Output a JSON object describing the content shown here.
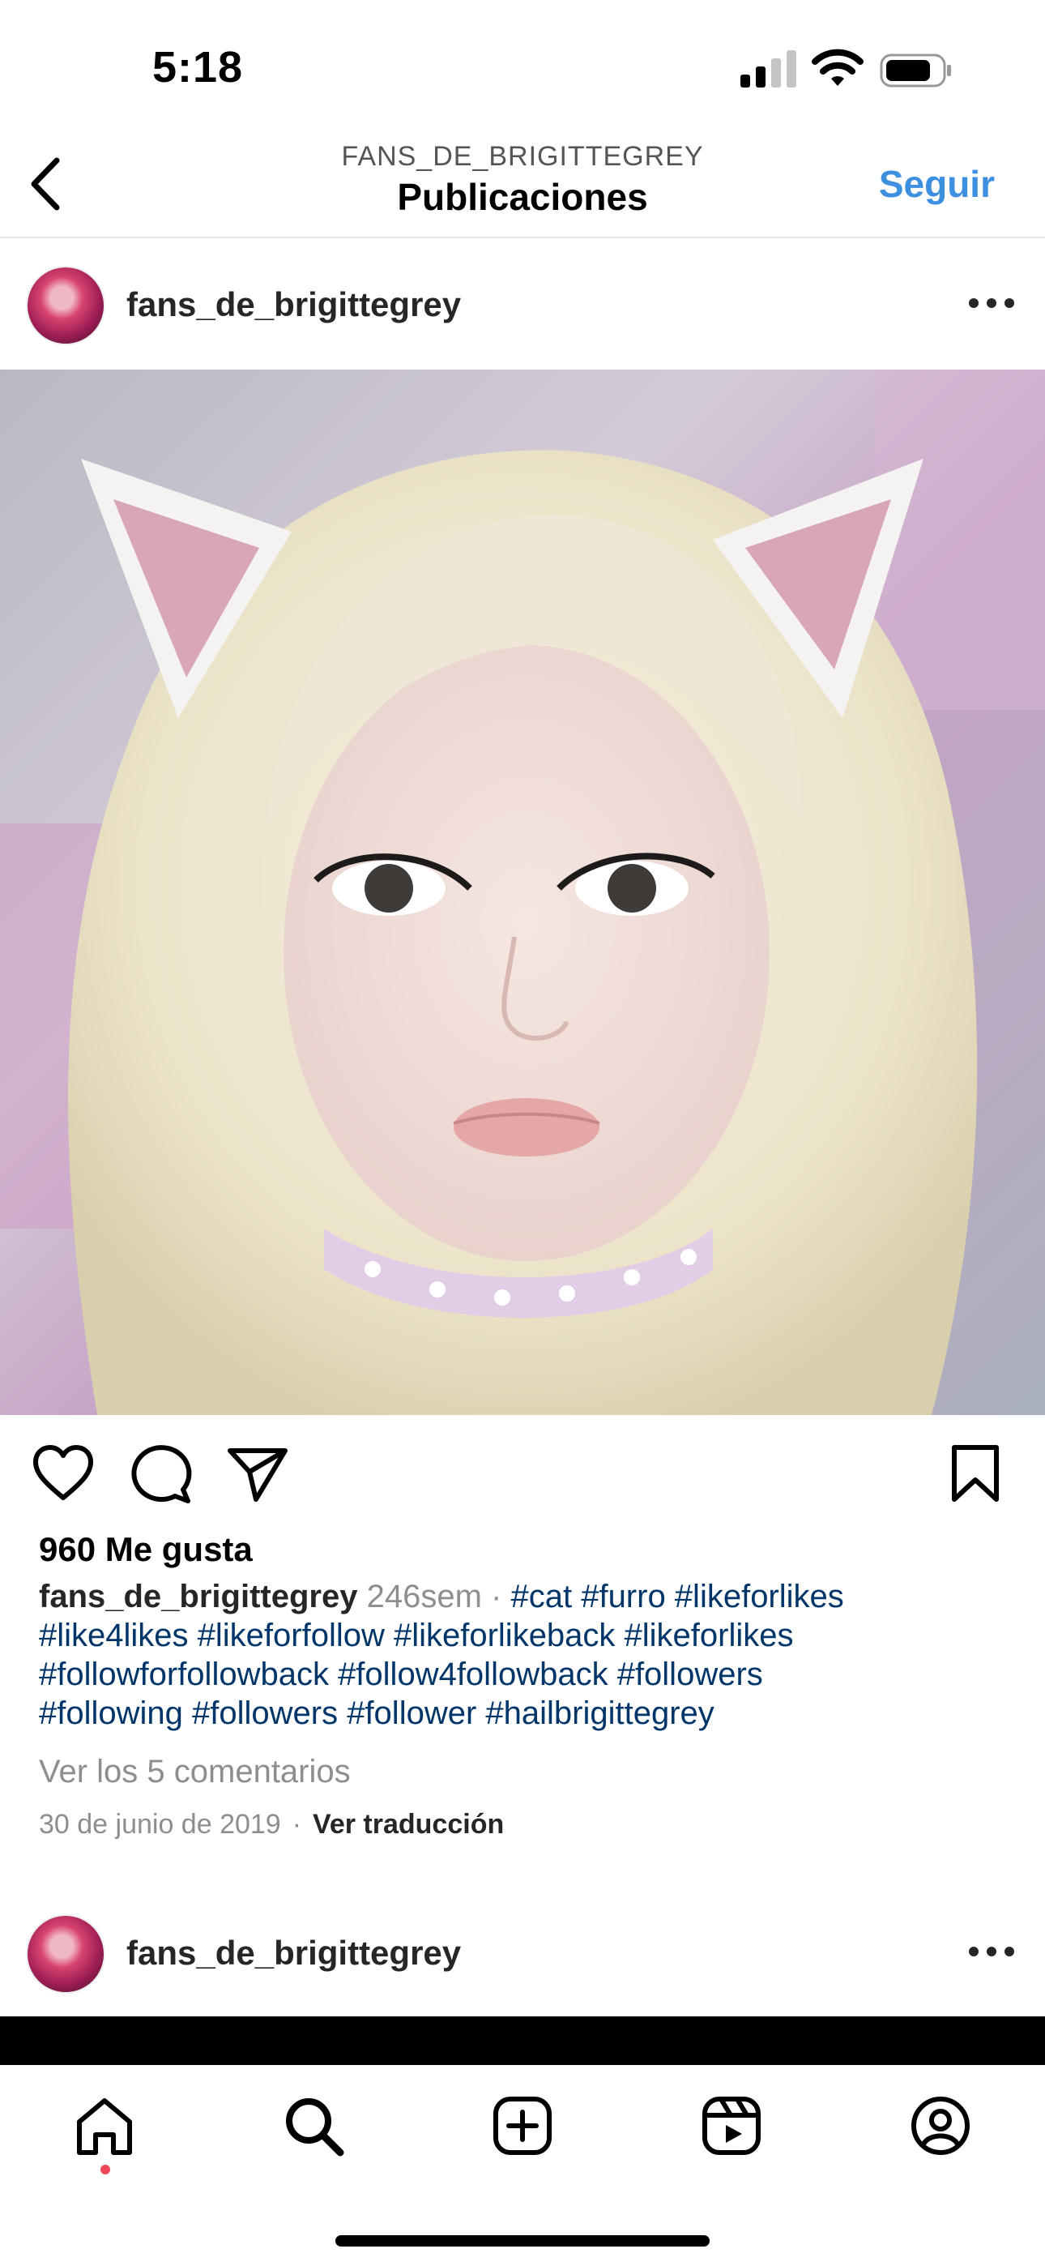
{
  "status_bar": {
    "time": "5:18"
  },
  "header": {
    "account_handle": "FANS_DE_BRIGITTEGREY",
    "title": "Publicaciones",
    "follow_label": "Seguir"
  },
  "post1": {
    "username": "fans_de_brigittegrey",
    "likes": "960 Me gusta",
    "caption_user": "fans_de_brigittegrey",
    "caption_time": "246sem",
    "caption_dot": "·",
    "hashtags_line1": "#cat #furro #likeforlikes",
    "hashtags_line2": "#like4likes #likeforfollow #likeforlikeback #likeforlikes",
    "hashtags_line3": "#followforfollowback #follow4followback #followers",
    "hashtags_line4": "#following #followers #follower #hailbrigittegrey",
    "view_comments": "Ver los 5 comentarios",
    "date": "30 de junio de 2019",
    "date_sep": "·",
    "translate": "Ver traducción"
  },
  "post2": {
    "username": "fans_de_brigittegrey"
  },
  "icons": {
    "like": "heart-icon",
    "comment": "comment-icon",
    "share": "send-icon",
    "save": "bookmark-icon",
    "home": "home-icon",
    "search": "search-icon",
    "create": "plus-square-icon",
    "reels": "reels-icon",
    "profile": "profile-icon"
  },
  "colors": {
    "accent": "#3d8fe0",
    "hashtag": "#003569",
    "muted": "#8e8e8e",
    "notification_dot": "#ed4956"
  }
}
